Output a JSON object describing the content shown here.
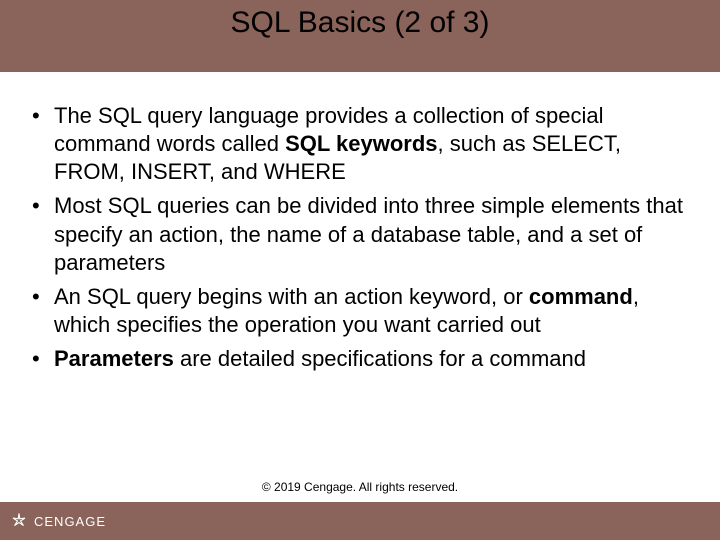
{
  "title": "SQL Basics (2 of 3)",
  "bullets": {
    "b0": {
      "p0": "The SQL query language provides a collection of special command words called ",
      "p1": "SQL keywords",
      "p2": ", such as SELECT, FROM, INSERT, and WHERE"
    },
    "b1": "Most SQL queries can be divided into three simple elements that specify an action, the name of a database table, and a set of parameters",
    "b2": {
      "p0": "An SQL query begins with an action keyword, or ",
      "p1": "command",
      "p2": ", which specifies the operation you want carried out"
    },
    "b3": {
      "p0": "Parameters",
      "p1": " are detailed specifications for a command"
    }
  },
  "footer": {
    "brand": "CENGAGE",
    "copyright": "© 2019 Cengage. All rights reserved."
  }
}
